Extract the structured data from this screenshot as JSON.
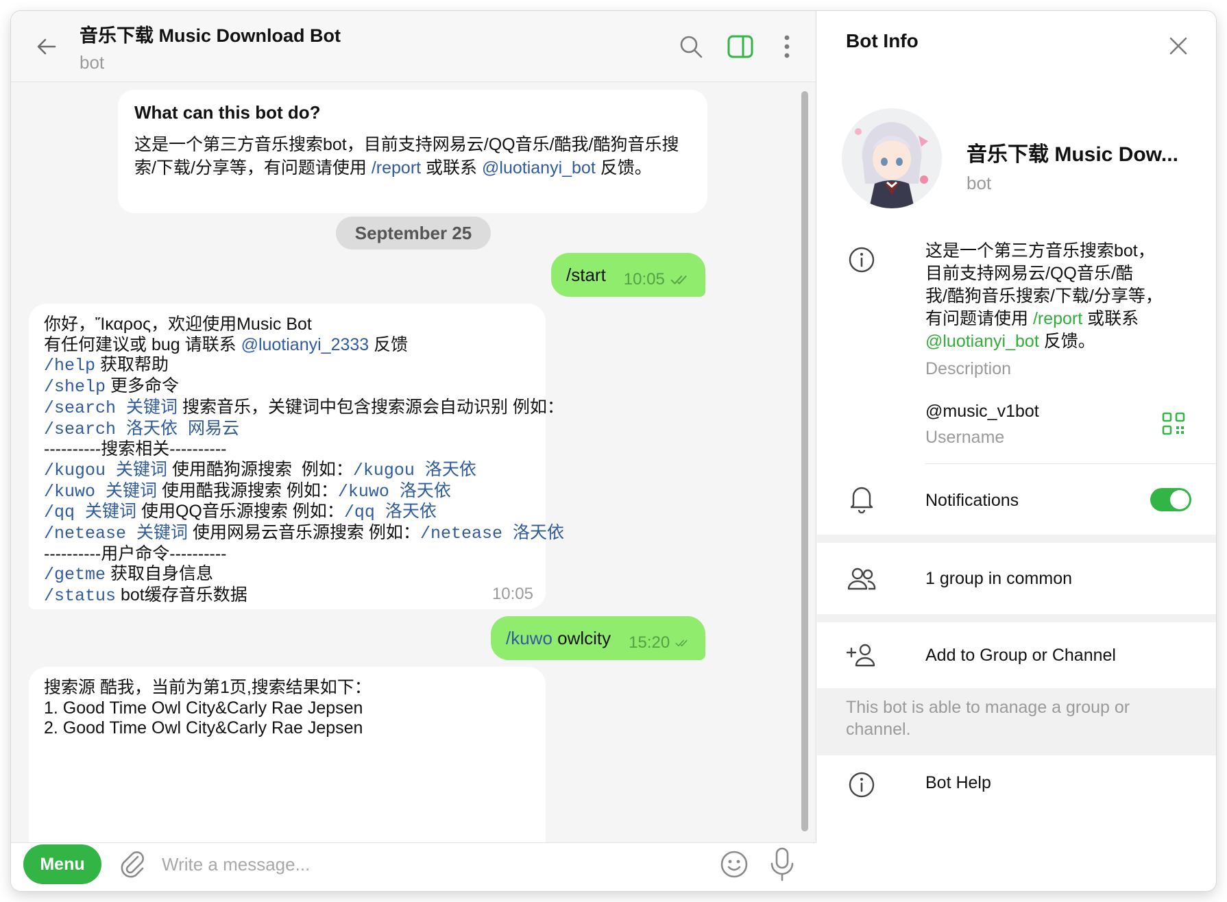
{
  "header": {
    "title": "音乐下载 Music Download Bot",
    "subtitle": "bot"
  },
  "intro": {
    "title": "What can this bot do?",
    "text_before": "这是一个第三方音乐搜索bot，目前支持网易云/QQ音乐/酷我/酷狗音乐搜索/下载/分享等，有问题请使用 ",
    "cmd_report": "/report",
    "text_mid": " 或联系 ",
    "mention": "@luotianyi_bot",
    "text_after": " 反馈。"
  },
  "date_separator": "September 25",
  "messages": {
    "out1": {
      "text": "/start",
      "time": "10:05"
    },
    "in1": {
      "time": "10:05",
      "line1": "你好，Ἴκαρος，欢迎使用Music Bot",
      "line2_a": "有任何建议或 bug 请联系 ",
      "line2_mention": "@luotianyi_2333",
      "line2_b": " 反馈",
      "help_cmd": "/help",
      "help_desc": " 获取帮助",
      "shelp_cmd": "/shelp",
      "shelp_desc": " 更多命令",
      "search_cmd": "/search 关键词",
      "search_desc": " 搜索音乐，关键词中包含搜索源会自动识别 例如：",
      "search_example": "/search 洛天依 网易云",
      "sep_search": "----------搜索相关----------",
      "kugou_cmd": "/kugou 关键词",
      "kugou_desc": " 使用酷狗源搜索  例如：",
      "kugou_ex": "/kugou 洛天依",
      "kuwo_cmd": "/kuwo 关键词",
      "kuwo_desc": " 使用酷我源搜索 例如：",
      "kuwo_ex": "/kuwo 洛天依",
      "qq_cmd": "/qq 关键词",
      "qq_desc": " 使用QQ音乐源搜索 例如：",
      "qq_ex": "/qq 洛天依",
      "netease_cmd": "/netease 关键词",
      "netease_desc": " 使用网易云音乐源搜索 例如：",
      "netease_ex": "/netease 洛天依",
      "sep_user": "----------用户命令----------",
      "getme_cmd": "/getme",
      "getme_desc": " 获取自身信息",
      "status_cmd": "/status",
      "status_desc": " bot缓存音乐数据"
    },
    "out2": {
      "cmd": "/kuwo",
      "text": " owlcity",
      "time": "15:20"
    },
    "in2": {
      "line1": "搜索源 酷我，当前为第1页,搜索结果如下：",
      "line2": "1. Good Time Owl City&Carly Rae Jepsen",
      "line3": "2. Good Time Owl City&Carly Rae Jepsen"
    }
  },
  "composer": {
    "menu_label": "Menu",
    "placeholder": "Write a message..."
  },
  "info_panel": {
    "title": "Bot Info",
    "name": "音乐下载 Music Dow...",
    "subtitle": "bot",
    "description": {
      "line1": "这是一个第三方音乐搜索bot，",
      "line2": "目前支持网易云/QQ音乐/酷",
      "line3": "我/酷狗音乐搜索/下载/分享等，",
      "line4_a": "有问题请使用 ",
      "line4_link": "/report",
      "line4_b": " 或联系",
      "line5_link": "@luotianyi_bot",
      "line5_b": " 反馈。",
      "label": "Description"
    },
    "username": {
      "value": "@music_v1bot",
      "label": "Username"
    },
    "notifications": {
      "label": "Notifications",
      "enabled": true
    },
    "groups_in_common": "1 group in common",
    "add_to_group": "Add to Group or Channel",
    "note": "This bot is able to manage a group or channel.",
    "bot_help": "Bot Help"
  },
  "colors": {
    "accent_green": "#32b545",
    "outgoing_bubble": "#8fec6c",
    "link_blue": "#2f5b9e",
    "link_green": "#2fae38"
  }
}
